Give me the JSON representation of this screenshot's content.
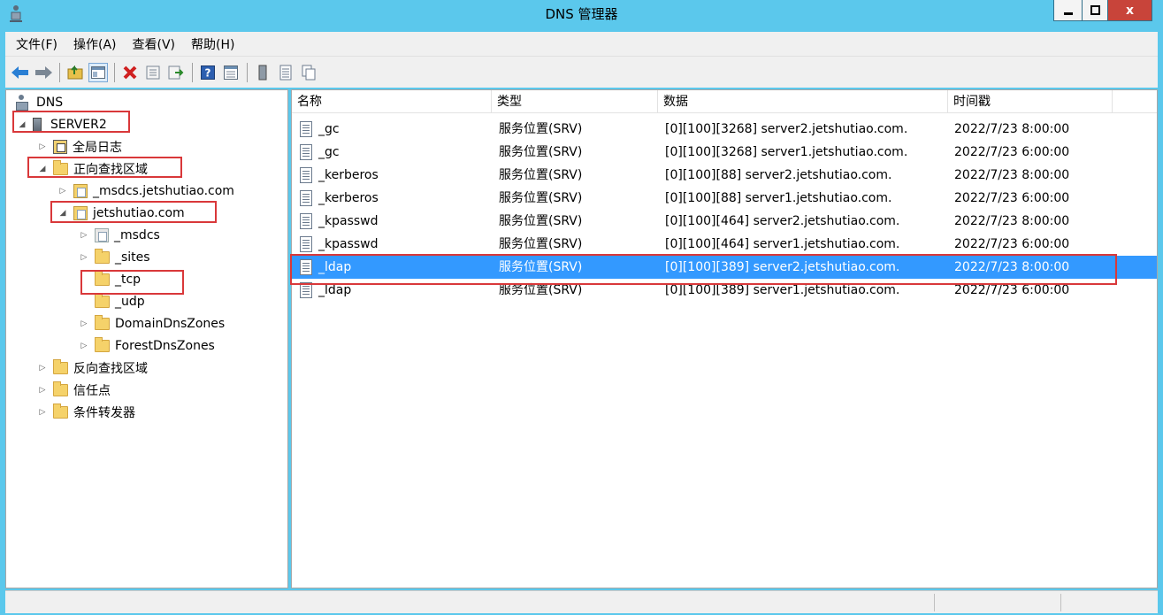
{
  "window": {
    "title": "DNS 管理器",
    "close_glyph": "x"
  },
  "menu": [
    "文件(F)",
    "操作(A)",
    "查看(V)",
    "帮助(H)"
  ],
  "toolbar_icons": [
    "back-arrow-icon",
    "forward-arrow-icon",
    "up-folder-icon",
    "show-hide-tree-icon",
    "delete-icon",
    "properties-icon",
    "export-list-icon",
    "help-icon",
    "view-icon",
    "server-icon",
    "record-icon",
    "copy-icon"
  ],
  "tree": {
    "root": "DNS",
    "server": "SERVER2",
    "global_logs": "全局日志",
    "forward_zones": "正向查找区域",
    "msdcs_zone": "_msdcs.jetshutiao.com",
    "main_zone": "jetshutiao.com",
    "sub_msdcs": "_msdcs",
    "sub_sites": "_sites",
    "sub_tcp": "_tcp",
    "sub_udp": "_udp",
    "domain_dns": "DomainDnsZones",
    "forest_dns": "ForestDnsZones",
    "reverse_zones": "反向查找区域",
    "trust_points": "信任点",
    "conditional_forwarders": "条件转发器"
  },
  "columns": [
    "名称",
    "类型",
    "数据",
    "时间戳"
  ],
  "records": [
    {
      "name": "_gc",
      "type": "服务位置(SRV)",
      "data": "[0][100][3268] server2.jetshutiao.com.",
      "timestamp": "2022/7/23 8:00:00"
    },
    {
      "name": "_gc",
      "type": "服务位置(SRV)",
      "data": "[0][100][3268] server1.jetshutiao.com.",
      "timestamp": "2022/7/23 6:00:00"
    },
    {
      "name": "_kerberos",
      "type": "服务位置(SRV)",
      "data": "[0][100][88] server2.jetshutiao.com.",
      "timestamp": "2022/7/23 8:00:00"
    },
    {
      "name": "_kerberos",
      "type": "服务位置(SRV)",
      "data": "[0][100][88] server1.jetshutiao.com.",
      "timestamp": "2022/7/23 6:00:00"
    },
    {
      "name": "_kpasswd",
      "type": "服务位置(SRV)",
      "data": "[0][100][464] server2.jetshutiao.com.",
      "timestamp": "2022/7/23 8:00:00"
    },
    {
      "name": "_kpasswd",
      "type": "服务位置(SRV)",
      "data": "[0][100][464] server1.jetshutiao.com.",
      "timestamp": "2022/7/23 6:00:00"
    },
    {
      "name": "_ldap",
      "type": "服务位置(SRV)",
      "data": "[0][100][389] server2.jetshutiao.com.",
      "timestamp": "2022/7/23 8:00:00"
    },
    {
      "name": "_ldap",
      "type": "服务位置(SRV)",
      "data": "[0][100][389] server1.jetshutiao.com.",
      "timestamp": "2022/7/23 6:00:00"
    }
  ],
  "selected_record_index": 6,
  "colors": {
    "title_bg": "#5bc8ec",
    "selection": "#3399ff",
    "highlight_box": "#d9383a",
    "close_button": "#c8443a"
  }
}
